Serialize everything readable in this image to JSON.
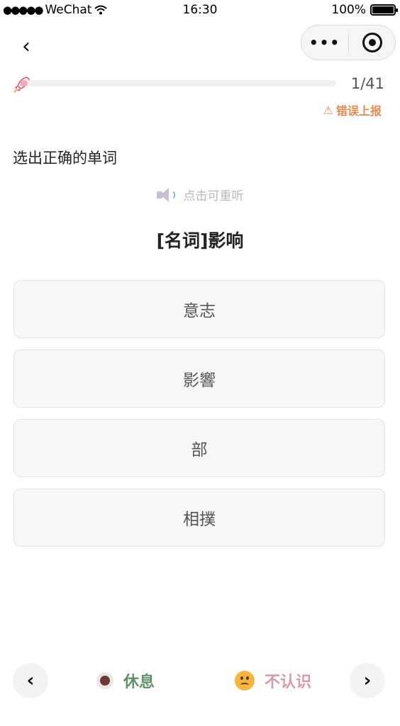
{
  "status_bar": {
    "signal": "●●●●●",
    "carrier": "WeChat",
    "time": "16:30",
    "battery": "100%"
  },
  "nav": {
    "back_glyph": "‹",
    "more_glyph": "•••"
  },
  "progress": {
    "current": 1,
    "total": 41,
    "text": "1/41",
    "fraction": 0.024
  },
  "report": {
    "icon": "⚠",
    "label": "错误上报"
  },
  "question": {
    "instruction": "选出正确的单词",
    "replay_label": "点击可重听",
    "prompt": "[名词]影响"
  },
  "options": [
    {
      "label": "意志"
    },
    {
      "label": "影響"
    },
    {
      "label": "部"
    },
    {
      "label": "相撲"
    }
  ],
  "bottom_bar": {
    "prev_glyph": "‹",
    "rest_label": "休息",
    "unknown_label": "不认识",
    "next_glyph": "›"
  },
  "colors": {
    "progress_fill": "#f5a9b8",
    "report": "#e58a4e",
    "rest": "#5c9468",
    "unknown": "#d99aa8"
  }
}
